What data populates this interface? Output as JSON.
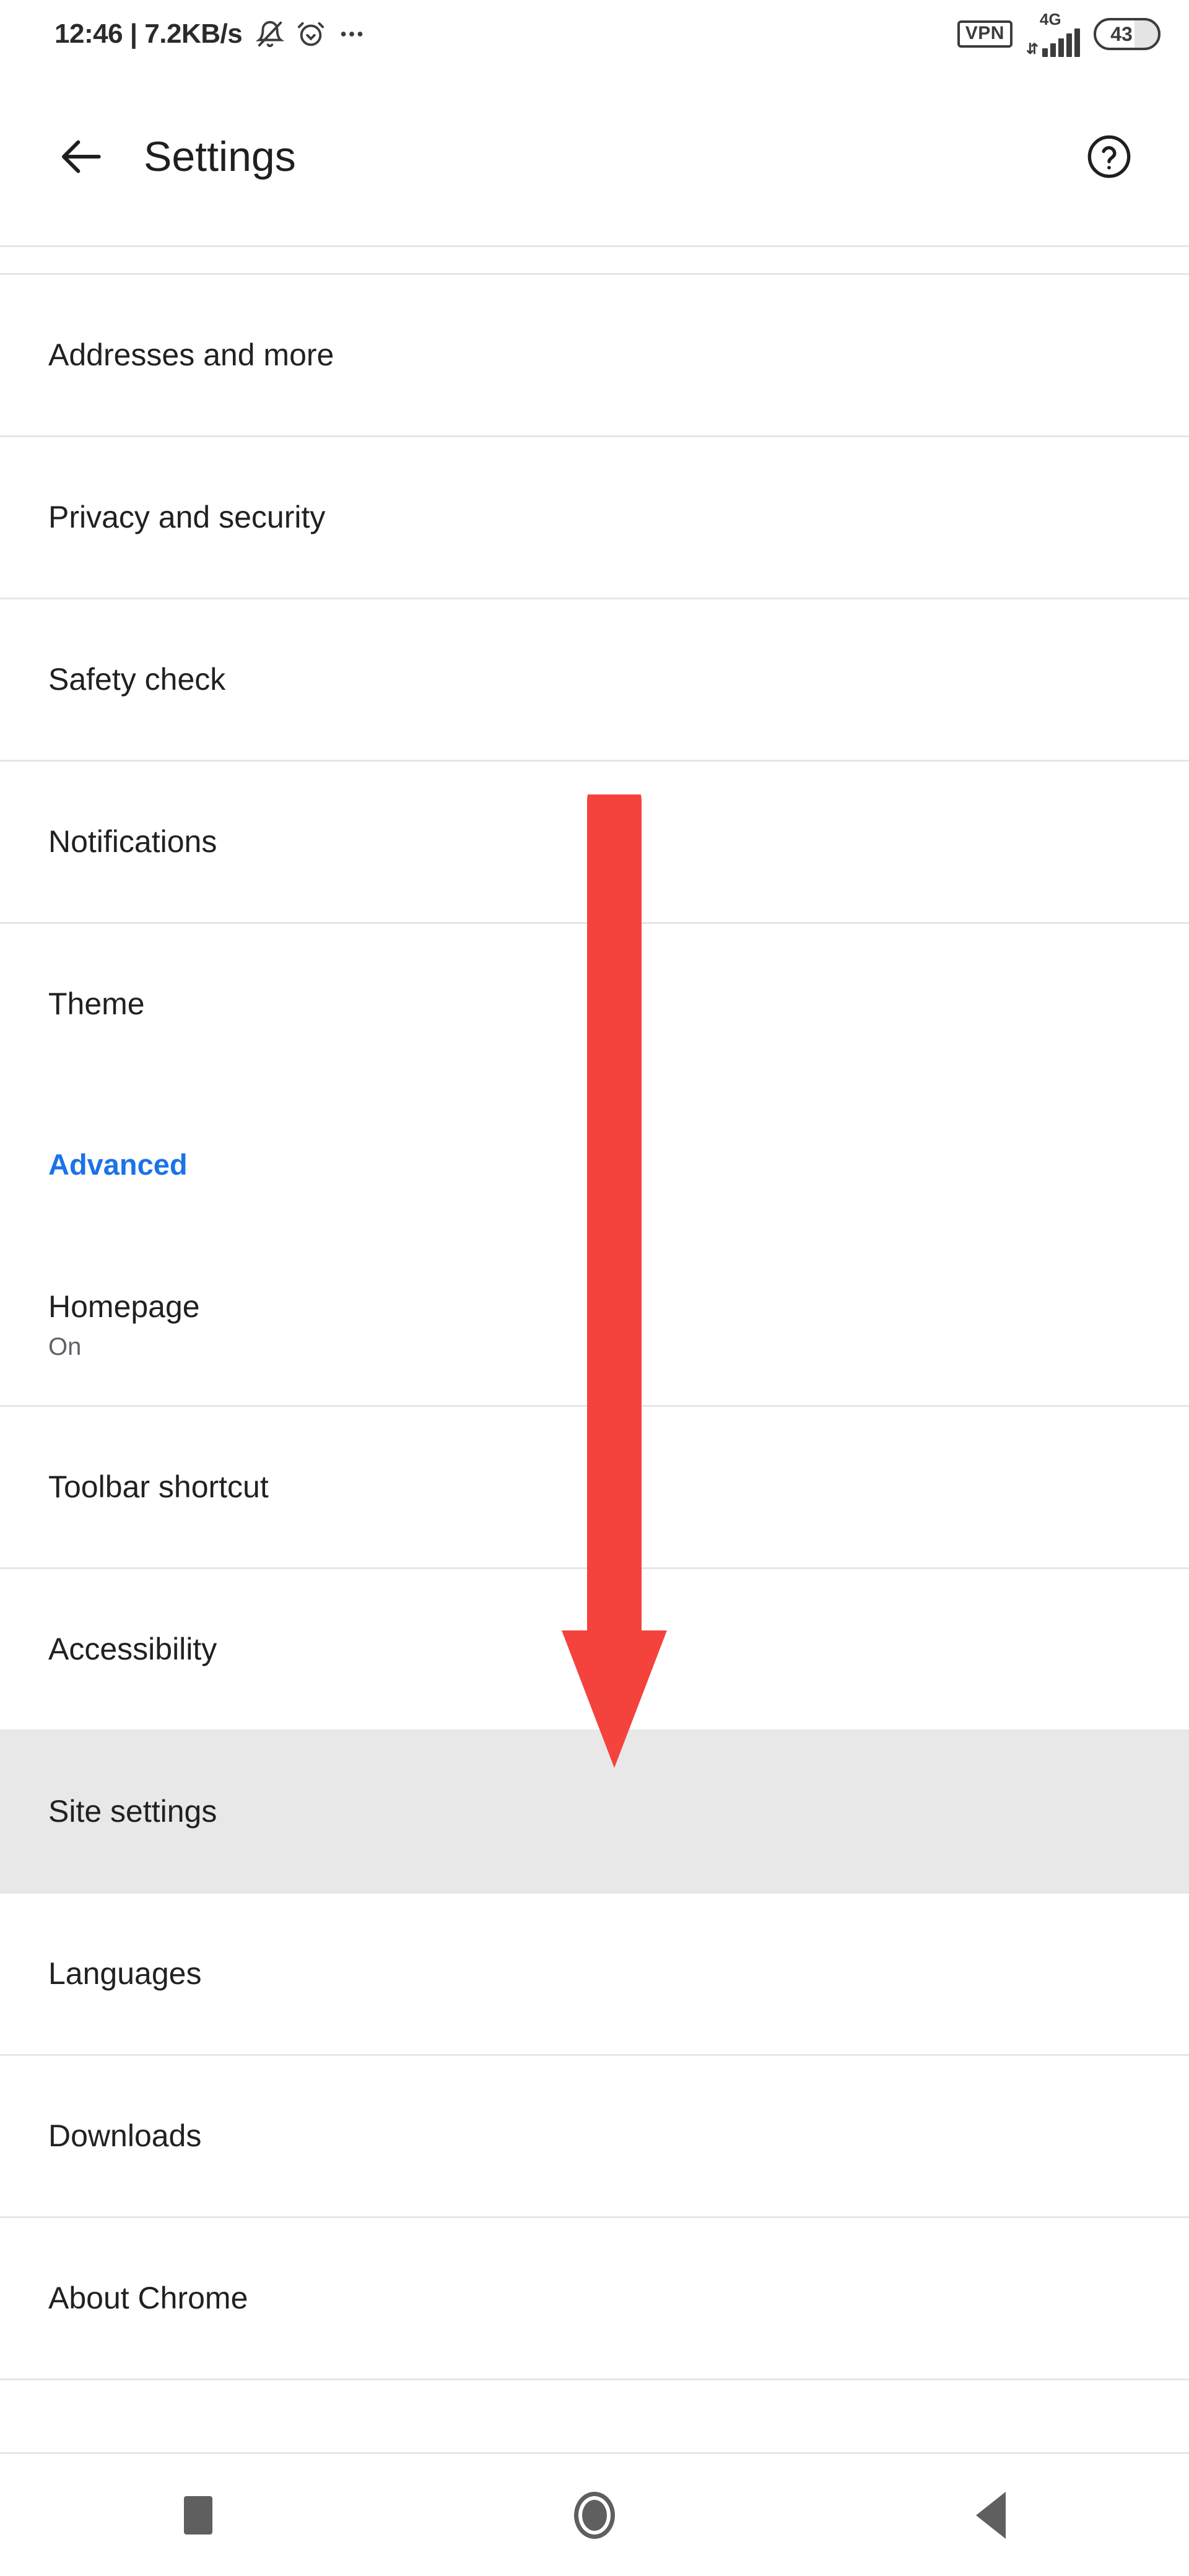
{
  "status_bar": {
    "clock": "12:46",
    "separator": "|",
    "network_speed": "7.2KB/s",
    "left_icons": [
      "bell-muted-icon",
      "alarm-icon",
      "more-horizontal-icon"
    ],
    "vpn_label": "VPN",
    "network_type": "4G",
    "signal_bars": 5,
    "battery_level": "43",
    "right_icons": [
      "vpn-icon",
      "signal-icon",
      "battery-icon"
    ]
  },
  "app_bar": {
    "back_icon": "arrow-left-icon",
    "title": "Settings",
    "help_icon": "help-circle-icon"
  },
  "settings_list": {
    "items": [
      {
        "type": "item",
        "label": "Addresses and more",
        "subtitle": "",
        "highlighted": false
      },
      {
        "type": "item",
        "label": "Privacy and security",
        "subtitle": "",
        "highlighted": false
      },
      {
        "type": "item",
        "label": "Safety check",
        "subtitle": "",
        "highlighted": false
      },
      {
        "type": "item",
        "label": "Notifications",
        "subtitle": "",
        "highlighted": false
      },
      {
        "type": "item",
        "label": "Theme",
        "subtitle": "",
        "highlighted": false
      },
      {
        "type": "section",
        "label": "Advanced",
        "subtitle": "",
        "highlighted": false
      },
      {
        "type": "item",
        "label": "Homepage",
        "subtitle": "On",
        "highlighted": false
      },
      {
        "type": "item",
        "label": "Toolbar shortcut",
        "subtitle": "",
        "highlighted": false
      },
      {
        "type": "item",
        "label": "Accessibility",
        "subtitle": "",
        "highlighted": false
      },
      {
        "type": "item",
        "label": "Site settings",
        "subtitle": "",
        "highlighted": true
      },
      {
        "type": "item",
        "label": "Languages",
        "subtitle": "",
        "highlighted": false
      },
      {
        "type": "item",
        "label": "Downloads",
        "subtitle": "",
        "highlighted": false
      },
      {
        "type": "item",
        "label": "About Chrome",
        "subtitle": "",
        "highlighted": false
      }
    ]
  },
  "annotation": {
    "name": "down-arrow-annotation",
    "shape": "down-arrow",
    "color": "#f4433c",
    "points_to": "Site settings"
  },
  "nav_bar": {
    "buttons": [
      {
        "icon": "square-recents-icon",
        "label": "Recents"
      },
      {
        "icon": "circle-home-icon",
        "label": "Home"
      },
      {
        "icon": "triangle-back-icon",
        "label": "Back"
      }
    ]
  },
  "colors": {
    "accent_blue": "#1a73e8",
    "annotation_red": "#f4433c",
    "highlight_gray": "#e8e8e8",
    "divider": "#e6e6e6",
    "text_primary": "#212121",
    "text_secondary": "#5f6368"
  }
}
